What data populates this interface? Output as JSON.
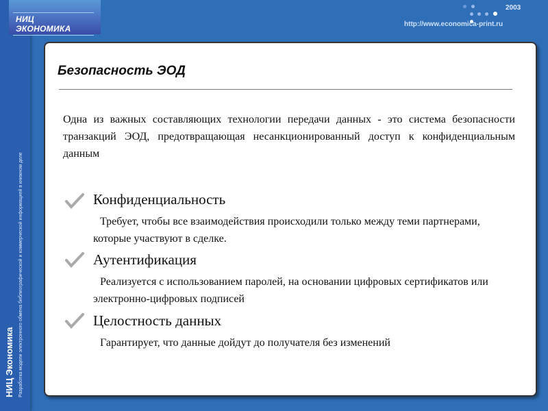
{
  "header": {
    "logo_text": "НИЦ ЭКОНОМИКА",
    "year": "2003",
    "url": "http://www.economica-print.ru"
  },
  "sidebar": {
    "org": "НИЦ Экономика",
    "project": "Разработка модели электронного обмена библиографической и коммерческой информацией в книжном деле"
  },
  "slide": {
    "title": "Безопасность ЭОД",
    "intro": "Одна из важных составляющих технологии передачи данных - это система безопасности транзакций ЭОД, предотвращающая несанкционированный доступ к конфиденциальным данным",
    "items": [
      {
        "heading": "Конфиденциальность",
        "text": "Требует, чтобы все взаимодействия происходили только между теми партнерами, которые участвуют в сделке."
      },
      {
        "heading": "Аутентификация",
        "text": "Реализуется с использованием паролей, на основании цифровых сертификатов или электронно-цифровых подписей"
      },
      {
        "heading": "Целостность данных",
        "text": "Гарантирует, что данные дойдут до получателя без изменений"
      }
    ]
  }
}
